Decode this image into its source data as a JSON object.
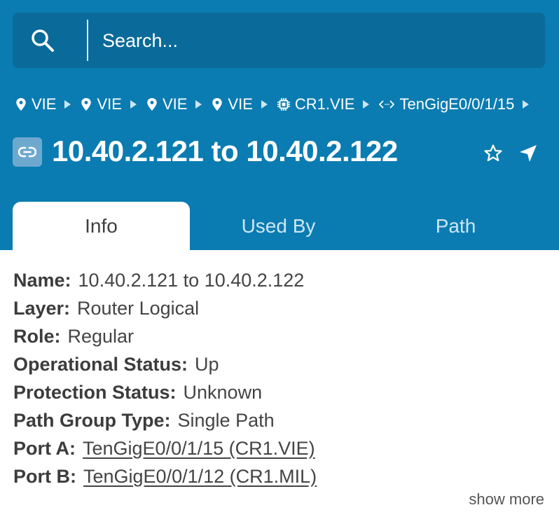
{
  "search": {
    "placeholder": "Search..."
  },
  "breadcrumb": [
    {
      "icon": "location-pin-icon",
      "label": "VIE"
    },
    {
      "icon": "location-pin-icon",
      "label": "VIE"
    },
    {
      "icon": "location-pin-icon",
      "label": "VIE"
    },
    {
      "icon": "location-pin-icon",
      "label": "VIE"
    },
    {
      "icon": "chip-icon",
      "label": "CR1.VIE"
    },
    {
      "icon": "bidirectional-arrow-icon",
      "label": "TenGigE0/0/1/15"
    }
  ],
  "title": {
    "icon": "link-icon",
    "text": "10.40.2.121 to 10.40.2.122"
  },
  "actions": {
    "favorite_icon": "star-icon",
    "locate_icon": "navigate-arrow-icon"
  },
  "tabs": [
    {
      "label": "Info",
      "active": true
    },
    {
      "label": "Used By",
      "active": false
    },
    {
      "label": "Path",
      "active": false
    }
  ],
  "info": {
    "name": {
      "label": "Name:",
      "value": "10.40.2.121 to 10.40.2.122"
    },
    "layer": {
      "label": "Layer:",
      "value": "Router Logical"
    },
    "role": {
      "label": "Role:",
      "value": "Regular"
    },
    "operational_status": {
      "label": "Operational Status:",
      "value": "Up"
    },
    "protection_status": {
      "label": "Protection Status:",
      "value": "Unknown"
    },
    "path_group_type": {
      "label": "Path Group Type:",
      "value": "Single Path"
    },
    "port_a": {
      "label": "Port A:",
      "value": "TenGigE0/0/1/15 (CR1.VIE)"
    },
    "port_b": {
      "label": "Port B:",
      "value": "TenGigE0/0/1/12 (CR1.MIL)"
    }
  },
  "show_more_label": "show more",
  "colors": {
    "header": "#0a7cb1",
    "search_bg": "#0a6a99",
    "text": "#444444"
  }
}
